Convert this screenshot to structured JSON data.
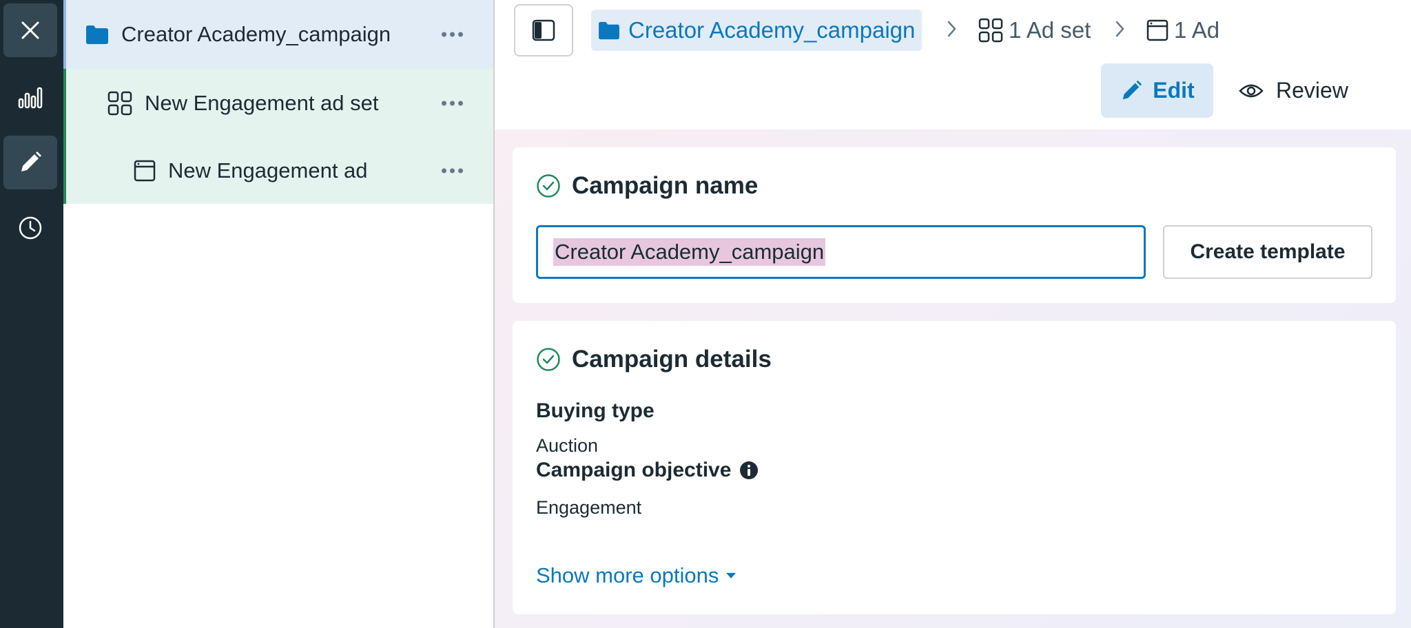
{
  "tree": {
    "campaign_label": "Creator Academy_campaign",
    "adset_label": "New Engagement ad set",
    "ad_label": "New Engagement ad"
  },
  "breadcrumb": {
    "campaign": "Creator Academy_campaign",
    "adset": "1 Ad set",
    "ad": "1 Ad"
  },
  "modes": {
    "edit": "Edit",
    "review": "Review"
  },
  "campaign_name_section": {
    "title": "Campaign name",
    "input_value": "Creator Academy_campaign",
    "create_template_label": "Create template"
  },
  "campaign_details_section": {
    "title": "Campaign details",
    "buying_type_label": "Buying type",
    "buying_type_value": "Auction",
    "objective_label": "Campaign objective",
    "objective_value": "Engagement",
    "show_more_label": "Show more options"
  },
  "colors": {
    "rail_bg": "#1c2b33",
    "accent_blue": "#0a78be",
    "success_green": "#1f8a5b",
    "selection_highlight": "#e6c7de"
  }
}
